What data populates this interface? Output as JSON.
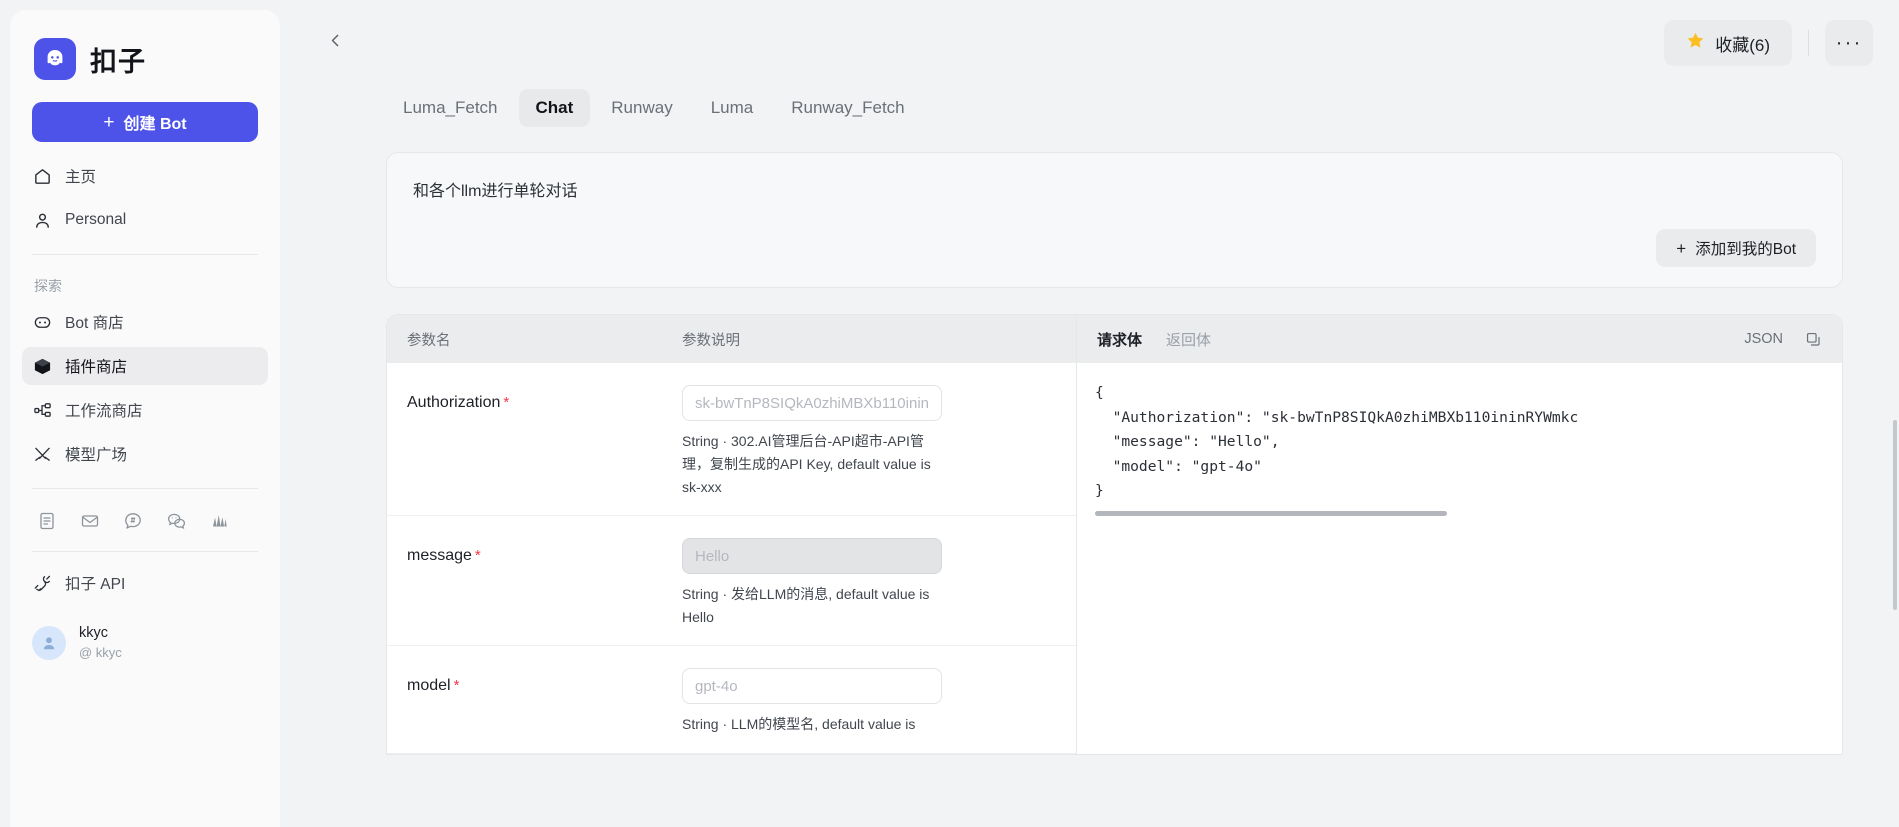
{
  "sidebar": {
    "brand": {
      "name": "扣子",
      "logo_icon": "coze-ghost-logo",
      "logo_color": "#4d53e8"
    },
    "create_button": {
      "label": "创建 Bot",
      "icon": "plus-icon"
    },
    "primary_items": [
      {
        "label": "主页",
        "icon": "home-icon"
      },
      {
        "label": "Personal",
        "icon": "user-icon"
      }
    ],
    "explore_label": "探索",
    "explore_items": [
      {
        "label": "Bot 商店",
        "icon": "bot-store-icon",
        "active": false
      },
      {
        "label": "插件商店",
        "icon": "plugin-cube-icon",
        "active": true
      },
      {
        "label": "工作流商店",
        "icon": "workflow-nodes-icon",
        "active": false
      },
      {
        "label": "模型广场",
        "icon": "model-plaza-icon",
        "active": false
      }
    ],
    "social_icons": [
      {
        "name": "docs-icon"
      },
      {
        "name": "mail-icon"
      },
      {
        "name": "discord-hash-icon"
      },
      {
        "name": "wechat-icon"
      },
      {
        "name": "feishu-icon"
      }
    ],
    "api_item": {
      "label": "扣子 API",
      "icon": "api-plug-icon"
    },
    "user": {
      "name": "kkyc",
      "handle": "@ kkyc",
      "avatar_icon": "avatar-person-icon"
    }
  },
  "topbar": {
    "back_icon": "chevron-left-icon",
    "favorite": {
      "label": "收藏(6)",
      "icon": "star-icon",
      "color": "#fbbf24"
    },
    "more": {
      "label": "···",
      "icon": "more-horizontal-icon"
    }
  },
  "tabs": [
    {
      "label": "Luma_Fetch",
      "active": false
    },
    {
      "label": "Chat",
      "active": true
    },
    {
      "label": "Runway",
      "active": false
    },
    {
      "label": "Luma",
      "active": false
    },
    {
      "label": "Runway_Fetch",
      "active": false
    }
  ],
  "description_card": {
    "text": "和各个llm进行单轮对话",
    "add_button": {
      "label": "添加到我的Bot",
      "icon": "plus-icon"
    }
  },
  "params_panel": {
    "headers": {
      "name": "参数名",
      "description": "参数说明"
    },
    "rows": [
      {
        "name": "Authorization",
        "required": "*",
        "placeholder": "sk-bwTnP8SIQkA0zhiMBXb110inin",
        "description": "String · 302.AI管理后台-API超市-API管理，复制生成的API Key, default value is sk-xxx",
        "hover": false
      },
      {
        "name": "message",
        "required": "*",
        "placeholder": "Hello",
        "description": "String · 发给LLM的消息, default value is Hello",
        "hover": true
      },
      {
        "name": "model",
        "required": "*",
        "placeholder": "gpt-4o",
        "description": "String · LLM的模型名, default value is",
        "hover": false
      }
    ]
  },
  "body_panel": {
    "tabs": [
      {
        "label": "请求体",
        "active": true
      },
      {
        "label": "返回体",
        "active": false
      }
    ],
    "format_label": "JSON",
    "copy_icon": "copy-icon",
    "code": "{\n  \"Authorization\": \"sk-bwTnP8SIQkA0zhiMBXb110ininRYWmkc\n  \"message\": \"Hello\",\n  \"model\": \"gpt-4o\"\n}"
  }
}
